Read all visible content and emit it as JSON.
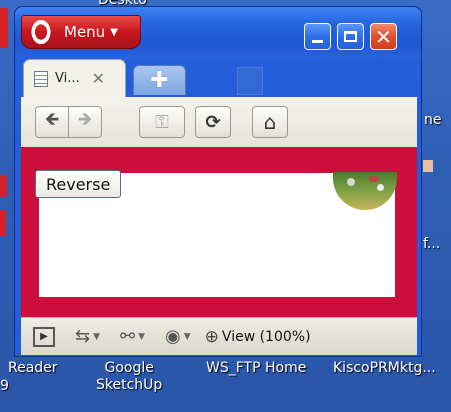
{
  "browser": {
    "menu_label": "Menu",
    "tab": {
      "title": "Vi...",
      "close_glyph": "✕"
    },
    "new_tab_glyph": "✚",
    "toolbar": {
      "back_glyph": "🡸",
      "forward_glyph": "🡺",
      "key_glyph": "⚿",
      "reload_glyph": "⟳",
      "home_glyph": "⌂"
    },
    "page": {
      "reverse_button_label": "Reverse"
    },
    "statusbar": {
      "panel_glyph": "▶",
      "zoom_label": "View (100%)",
      "zoom_glyph": "⊕"
    }
  },
  "window_controls": {
    "close_glyph": "✕"
  },
  "desktop": {
    "labels": {
      "top_fragment": "Deskto",
      "right_top": "ne",
      "right_mid": "f...",
      "reader": "Reader",
      "google_sketchup": "Google\nSketchUp",
      "ws_ftp": "WS_FTP Home",
      "kisco": "KiscoPRMktg...",
      "bottom_left_digit": "9"
    }
  },
  "colors": {
    "opera_red": "#c8171d",
    "page_frame": "#cc0f3a",
    "xp_blue": "#245edb"
  }
}
